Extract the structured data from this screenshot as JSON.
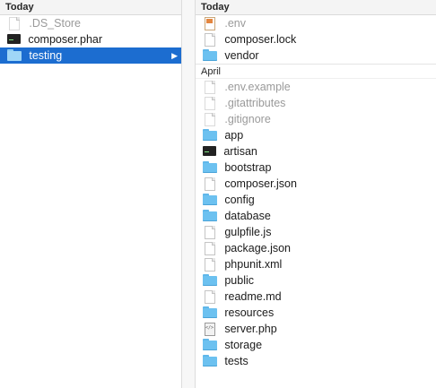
{
  "left_column": {
    "header": "Today",
    "items": [
      {
        "label": ".DS_Store",
        "icon": "document-icon",
        "hidden": true
      },
      {
        "label": "composer.phar",
        "icon": "executable-icon",
        "hidden": false
      },
      {
        "label": "testing",
        "icon": "folder-icon",
        "hidden": false,
        "selected": true
      }
    ]
  },
  "right_column": {
    "sections": [
      {
        "header": "Today",
        "items": [
          {
            "label": ".env",
            "icon": "env-file-icon",
            "hidden": true
          },
          {
            "label": "composer.lock",
            "icon": "document-icon"
          },
          {
            "label": "vendor",
            "icon": "folder-icon"
          }
        ]
      },
      {
        "header": "April",
        "items": [
          {
            "label": ".env.example",
            "icon": "document-icon",
            "hidden": true
          },
          {
            "label": ".gitattributes",
            "icon": "document-icon",
            "hidden": true
          },
          {
            "label": ".gitignore",
            "icon": "document-icon",
            "hidden": true
          },
          {
            "label": "app",
            "icon": "folder-icon"
          },
          {
            "label": "artisan",
            "icon": "executable-icon"
          },
          {
            "label": "bootstrap",
            "icon": "folder-icon"
          },
          {
            "label": "composer.json",
            "icon": "document-icon"
          },
          {
            "label": "config",
            "icon": "folder-icon"
          },
          {
            "label": "database",
            "icon": "folder-icon"
          },
          {
            "label": "gulpfile.js",
            "icon": "document-icon"
          },
          {
            "label": "package.json",
            "icon": "document-icon"
          },
          {
            "label": "phpunit.xml",
            "icon": "document-icon"
          },
          {
            "label": "public",
            "icon": "folder-icon"
          },
          {
            "label": "readme.md",
            "icon": "document-icon"
          },
          {
            "label": "resources",
            "icon": "folder-icon"
          },
          {
            "label": "server.php",
            "icon": "php-file-icon"
          },
          {
            "label": "storage",
            "icon": "folder-icon"
          },
          {
            "label": "tests",
            "icon": "folder-icon"
          }
        ]
      }
    ]
  },
  "colors": {
    "selection": "#1c6dd0",
    "folder": "#6cc1f0",
    "hidden_text": "#9a9a9a"
  }
}
